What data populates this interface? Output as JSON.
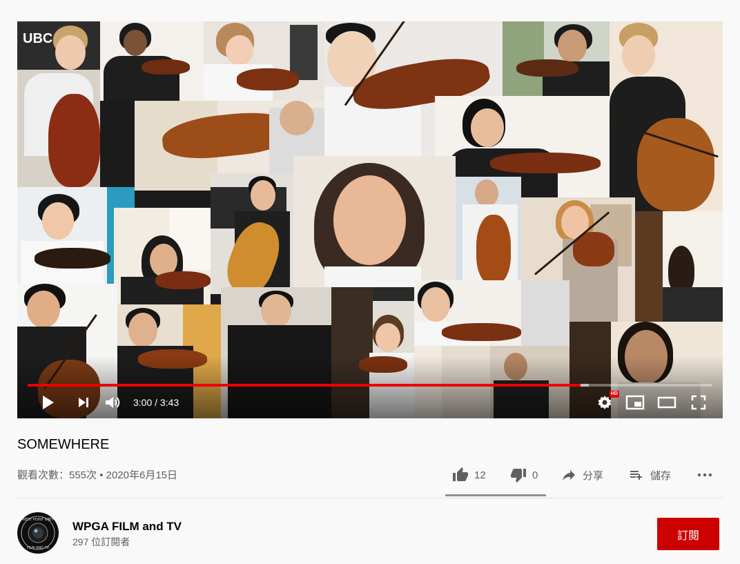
{
  "player": {
    "time_display": "3:00 / 3:43",
    "progress_fraction": 0.807,
    "buffered_fraction": 0.82,
    "hd_badge": "HD",
    "colors": {
      "progress": "#ee0000"
    },
    "controls": {
      "play_icon": "play-icon",
      "next_icon": "next-icon",
      "volume_icon": "volume-icon",
      "settings_icon": "gear-icon",
      "miniplayer_icon": "miniplayer-icon",
      "theater_icon": "theater-mode-icon",
      "fullscreen_icon": "fullscreen-icon"
    },
    "frame_text": "UBC"
  },
  "video": {
    "title": "SOMEWHERE",
    "meta": "觀看次數：555次 • 2020年6月15日"
  },
  "actions": {
    "like_count": "12",
    "dislike_count": "0",
    "share_label": "分享",
    "save_label": "儲存",
    "more_icon": "more-horizontal-icon"
  },
  "channel": {
    "name": "WPGA FILM and TV",
    "subscribers": "297 位訂閱者",
    "subscribe_label": "訂閱",
    "avatar_text_top": "WEST POINT GREY",
    "avatar_text_bottom": "FILM AND TV",
    "colors": {
      "subscribe": "#cc0000"
    }
  }
}
